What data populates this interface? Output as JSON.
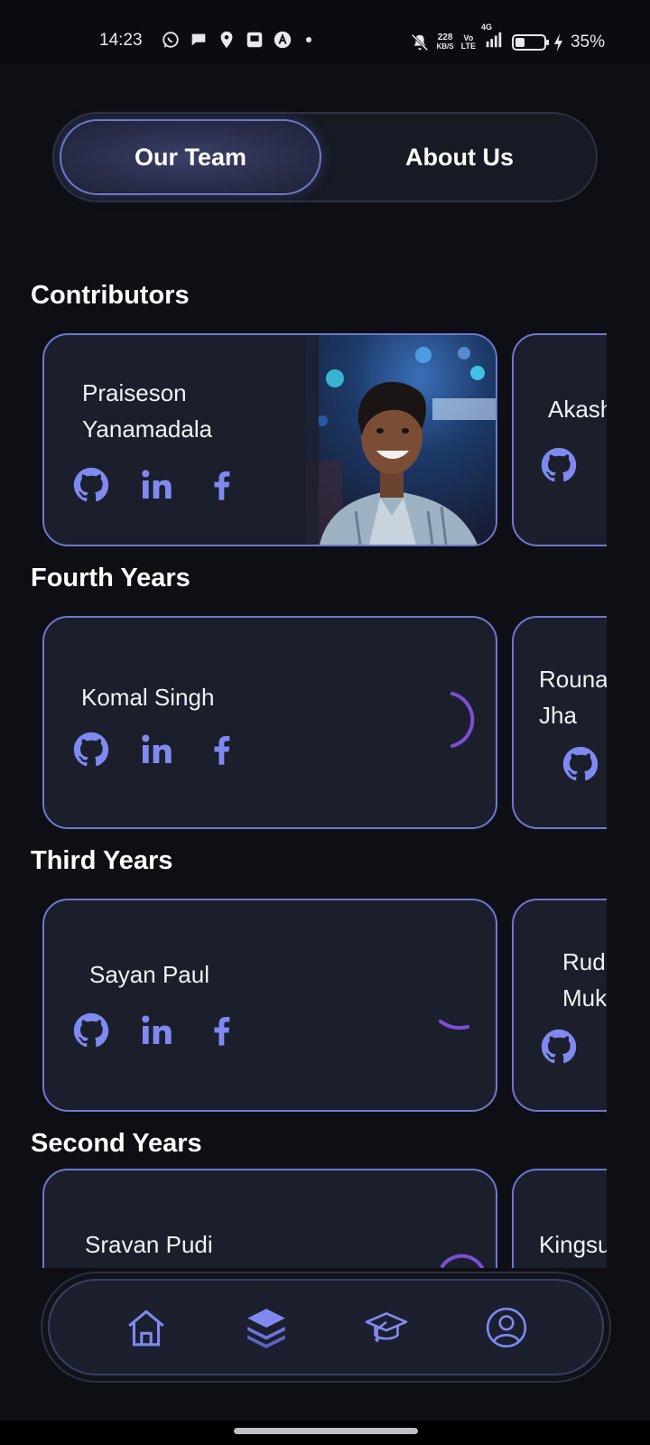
{
  "status_bar": {
    "time": "14:23",
    "network_speed_value": "228",
    "network_speed_unit": "KB/S",
    "volte_top": "Vo",
    "volte_bottom": "LTE",
    "network_type": "4G",
    "battery_percent": "35%",
    "battery_level": 0.35,
    "icons_left": [
      "whatsapp-icon",
      "chat-icon",
      "location-icon",
      "screen-icon",
      "a-icon",
      "dot-icon"
    ],
    "icons_right": [
      "mute-icon",
      "signal-icon",
      "battery-icon",
      "charging-icon"
    ]
  },
  "tabs": [
    {
      "label": "Our Team",
      "active": true
    },
    {
      "label": "About Us",
      "active": false
    }
  ],
  "sections": [
    {
      "title": "Contributors",
      "cards": [
        {
          "name": "Praiseson\nYanamadala",
          "socials": [
            "github-icon",
            "linkedin-icon",
            "facebook-icon"
          ],
          "has_photo": true
        },
        {
          "name": "Akash",
          "socials": [
            "github-icon",
            "linkedin-icon"
          ]
        }
      ]
    },
    {
      "title": "Fourth Years",
      "cards": [
        {
          "name": "Komal Singh",
          "socials": [
            "github-icon",
            "linkedin-icon",
            "facebook-icon"
          ],
          "loading": true
        },
        {
          "name": "Rouna\nJha",
          "socials": [
            "github-icon"
          ]
        }
      ]
    },
    {
      "title": "Third Years",
      "cards": [
        {
          "name": "Sayan Paul",
          "socials": [
            "github-icon",
            "linkedin-icon",
            "facebook-icon"
          ],
          "loading": true
        },
        {
          "name": "Rud\nMuk",
          "socials": [
            "github-icon",
            "linkedin-icon"
          ]
        }
      ]
    },
    {
      "title": "Second Years",
      "cards": [
        {
          "name": "Sravan Pudi",
          "loading": true
        },
        {
          "name": "Kingsu"
        }
      ]
    }
  ],
  "bottom_nav": [
    {
      "icon": "home-icon",
      "active": false
    },
    {
      "icon": "layers-icon",
      "active": true
    },
    {
      "icon": "graduation-cap-icon",
      "active": false
    },
    {
      "icon": "profile-icon",
      "active": false
    }
  ],
  "colors": {
    "background": "#0d0f14",
    "card": "#1b1f2c",
    "card_border": "#6f77d1",
    "accent": "#8089f0",
    "spinner": "#7b4fd6"
  }
}
